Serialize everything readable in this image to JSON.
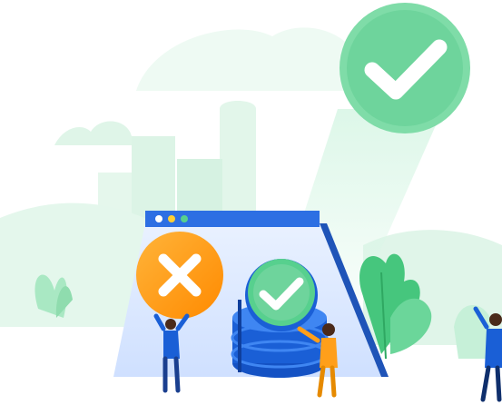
{
  "illustration": {
    "palette": {
      "mint_light": "#e7f8ef",
      "mint": "#c9f0da",
      "green": "#57d08e",
      "green_dark": "#36b56f",
      "blue": "#1a5fd6",
      "blue_light": "#3f86f2",
      "orange": "#ff9f1a",
      "window_bar": "#2d6fe3",
      "skin": "#4a2a1a"
    },
    "icons": {
      "success": "check-icon",
      "failure": "close-icon"
    }
  }
}
